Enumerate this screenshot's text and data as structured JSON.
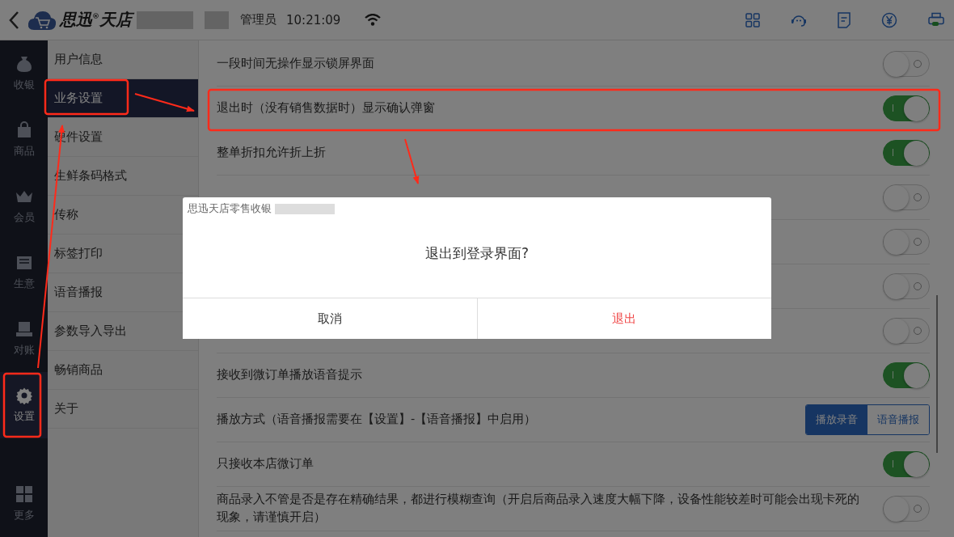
{
  "top_bar": {
    "logo_text_1": "思迅",
    "logo_mark": "®",
    "logo_text_2": "天店",
    "user_role": "管理员",
    "time": "10:21:09"
  },
  "nav_rail": [
    {
      "label": "收银",
      "selected": false
    },
    {
      "label": "商品",
      "selected": false
    },
    {
      "label": "会员",
      "selected": false
    },
    {
      "label": "生意",
      "selected": false
    },
    {
      "label": "对账",
      "selected": false
    },
    {
      "label": "设置",
      "selected": true
    }
  ],
  "more": {
    "label": "更多"
  },
  "submenu": [
    {
      "label": "用户信息",
      "selected": false
    },
    {
      "label": "业务设置",
      "selected": true
    },
    {
      "label": "硬件设置",
      "selected": false
    },
    {
      "label": "生鲜条码格式",
      "selected": false
    },
    {
      "label": "传称",
      "selected": false
    },
    {
      "label": "标签打印",
      "selected": false
    },
    {
      "label": "语音播报",
      "selected": false
    },
    {
      "label": "参数导入导出",
      "selected": false
    },
    {
      "label": "畅销商品",
      "selected": false
    },
    {
      "label": "关于",
      "selected": false
    }
  ],
  "settings": [
    {
      "kind": "toggle",
      "label": "一段时间无操作显示锁屏界面",
      "on": false
    },
    {
      "kind": "toggle",
      "label": "退出时（没有销售数据时）显示确认弹窗",
      "on": true
    },
    {
      "kind": "toggle",
      "label": "整单折扣允许折上折",
      "on": true
    },
    {
      "kind": "toggle",
      "on": false
    },
    {
      "kind": "toggle",
      "on": false
    },
    {
      "kind": "toggle",
      "on": false
    },
    {
      "kind": "toggle",
      "on": false
    },
    {
      "kind": "toggle",
      "label": "接收到微订单播放语音提示",
      "on": true
    },
    {
      "kind": "segmented",
      "label": "播放方式（语音播报需要在【设置】-【语音播报】中启用）",
      "options": [
        {
          "label": "播放录音",
          "selected": true
        },
        {
          "label": "语音播报",
          "selected": false
        }
      ]
    },
    {
      "kind": "toggle",
      "label": "只接收本店微订单",
      "on": true
    },
    {
      "kind": "toggle",
      "label": "商品录入不管是否是存在精确结果，都进行模糊查询（开启后商品录入速度大幅下降，设备性能较差时可能会出现卡死的现象，请谨慎开启）",
      "on": false
    }
  ],
  "dialog": {
    "title": "思迅天店零售收银",
    "message": "退出到登录界面?",
    "buttons": [
      {
        "kind": "cancel",
        "label": "取消"
      },
      {
        "kind": "confirm",
        "label": "退出"
      }
    ]
  }
}
